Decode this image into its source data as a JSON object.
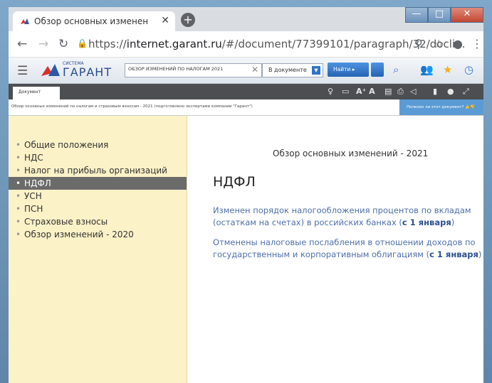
{
  "browser": {
    "tab_title": "Обзор основных изменений по...",
    "tab_close": "✕",
    "new_tab": "+",
    "url_prefix": "https://",
    "url_host": "internet.garant.ru",
    "url_path": "/#/document/77399101/paragraph/32/docli...",
    "window_buttons": {
      "minimize": "—",
      "maximize": "□",
      "close": "✕"
    }
  },
  "garant_toolbar": {
    "logo_small": "СИСТЕМА",
    "logo_text": "ГАРАНТ",
    "search_value": "ОБЗОР ИЗМЕНЕНИЙ ПО НАЛОГАМ 2021",
    "search_clear": "✕",
    "scope_value": "В документе",
    "find_label": "Найти"
  },
  "document_bar": {
    "tab_label": "Документ",
    "aa_label": "A⁺ A",
    "breadcrumb": "Обзор основных изменений по налогам и страховым взносам - 2021 (подготовлено экспертами компании \"Гарант\")",
    "useful_label": "Полезен ли этот документ?"
  },
  "sidebar": {
    "items": [
      {
        "label": "Общие положения",
        "active": false
      },
      {
        "label": "НДС",
        "active": false
      },
      {
        "label": "Налог на прибыль организаций",
        "active": false
      },
      {
        "label": "НДФЛ",
        "active": true
      },
      {
        "label": "УСН",
        "active": false
      },
      {
        "label": "ПСН",
        "active": false
      },
      {
        "label": "Страховые взносы",
        "active": false
      },
      {
        "label": "Обзор изменений - 2020",
        "active": false
      }
    ]
  },
  "document": {
    "subtitle": "Обзор основных изменений - 2021",
    "title": "НДФЛ",
    "links": [
      {
        "text_line1": "Изменен порядок налогообложения процентов по вкладам",
        "text_line2": "(остаткам на счетах) в российских банках (",
        "date": "с 1 января",
        "close": ")"
      },
      {
        "text_line1": "Отменены налоговые послабления в отношении доходов по",
        "text_line2": "государственным и корпоративным облигациям (",
        "date": "с 1 января",
        "close": ")"
      }
    ]
  }
}
